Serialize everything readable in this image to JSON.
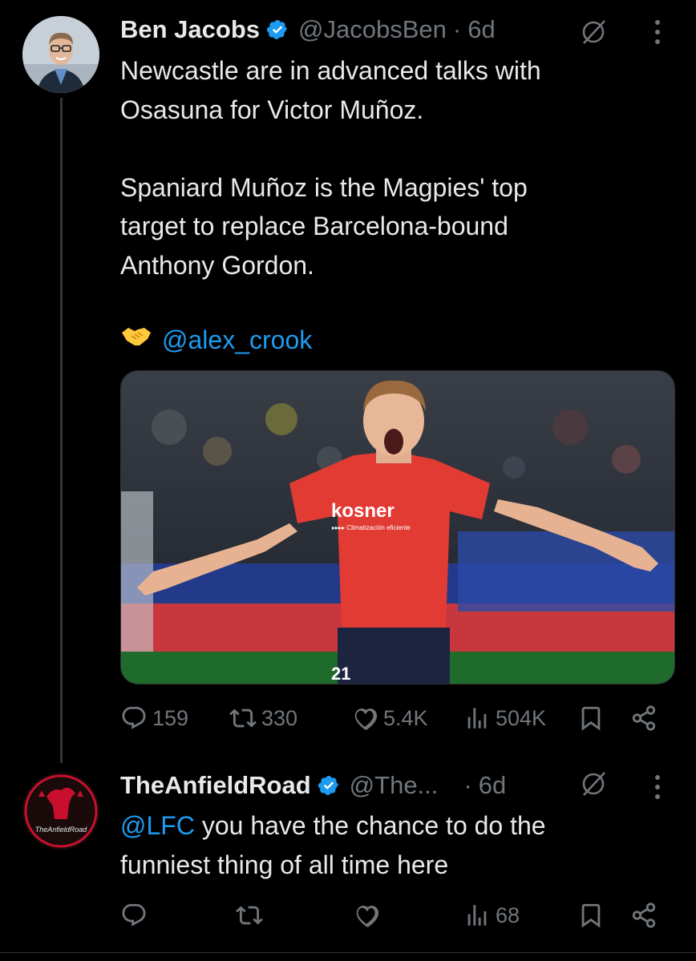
{
  "tweet": {
    "author_name": "Ben Jacobs",
    "handle": "@JacobsBen",
    "separator": "·",
    "time": "6d",
    "text_parts": {
      "line1": "Newcastle are in advanced talks with\nOsasuna for Victor Muñoz.\n\nSpaniard Muñoz is the Magpies' top\ntarget to replace Barcelona-bound\nAnthony Gordon."
    },
    "credit_mention": "@alex_crook",
    "media_shirt_text": "kosner",
    "media_shirt_subtext": "▸▸▸▸ Climatización eficiente",
    "media_shirt_number": "21",
    "stats": {
      "replies": "159",
      "reposts": "330",
      "likes": "5.4K",
      "views": "504K"
    }
  },
  "reply": {
    "author_name": "TheAnfieldRoad",
    "handle": "@The...",
    "separator": "·",
    "time": "6d",
    "mention": "@LFC",
    "text": " you have the chance to do the\nfunniest thing of all time here",
    "avatar_text": "TheAnfieldRoad",
    "stats": {
      "views": "68"
    }
  },
  "colors": {
    "background": "#000000",
    "text": "#e7e9ea",
    "muted": "#71767b",
    "link": "#1d9bf0",
    "verified": "#1d9bf0"
  },
  "icons": [
    "verified-badge-icon",
    "grok-icon",
    "more-icon",
    "handshake-icon",
    "reply-icon",
    "repost-icon",
    "like-icon",
    "views-icon",
    "bookmark-icon",
    "share-icon"
  ]
}
